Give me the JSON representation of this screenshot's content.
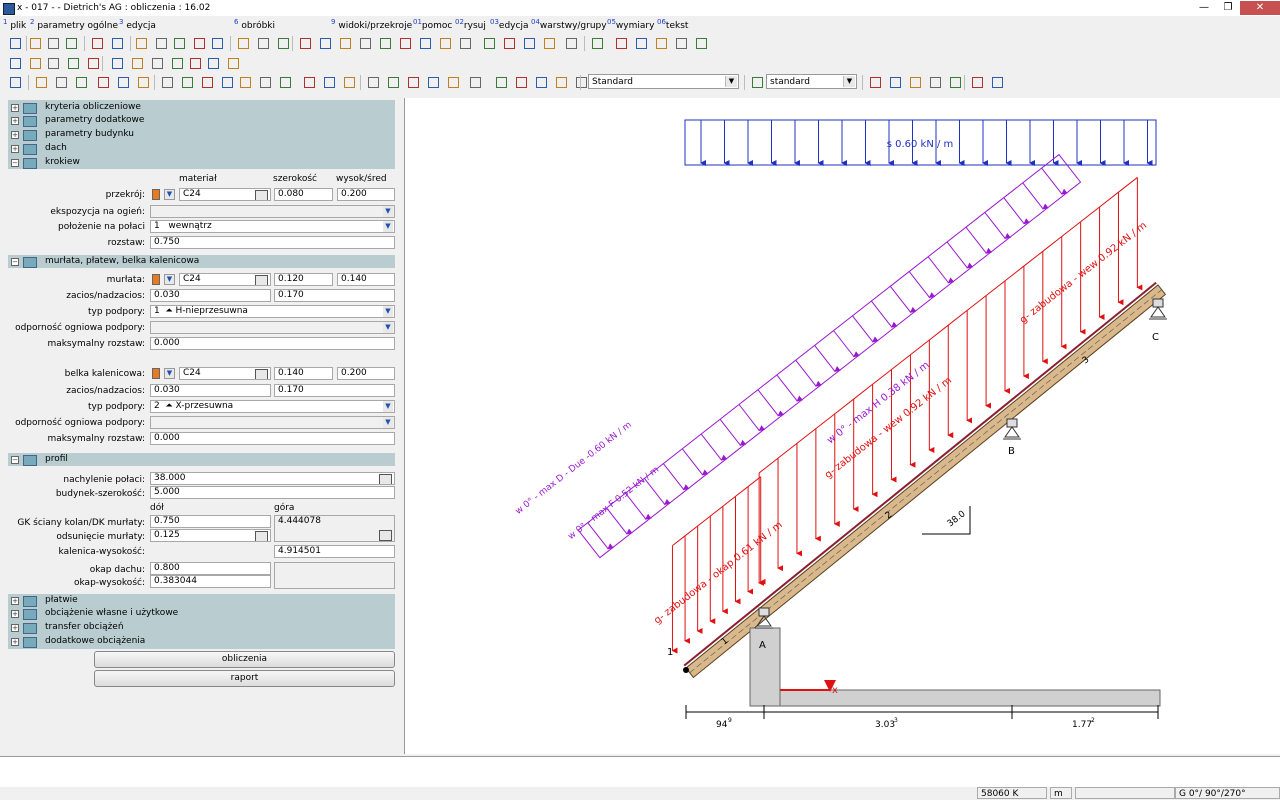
{
  "window": {
    "title": "x - 017 -  - Dietrich's AG : obliczenia : 16.02"
  },
  "menu": [
    {
      "num": "1",
      "label": "plik"
    },
    {
      "num": "2",
      "label": "parametry ogólne"
    },
    {
      "num": "3",
      "label": "edycja"
    },
    {
      "num": "6",
      "label": "obróbki"
    },
    {
      "num": "9",
      "label": "widoki/przekroje"
    },
    {
      "num": "01",
      "label": "pomoc"
    },
    {
      "num": "02",
      "label": "rysuj"
    },
    {
      "num": "03",
      "label": "edycja"
    },
    {
      "num": "04",
      "label": "warstwy/grupy"
    },
    {
      "num": "05",
      "label": "wymiary"
    },
    {
      "num": "06",
      "label": "tekst"
    }
  ],
  "toolbar": {
    "style_combo": "Standard",
    "line_combo": "standard"
  },
  "groups_top": [
    {
      "label": "kryteria obliczeniowe",
      "expanded": false
    },
    {
      "label": "parametry dodatkowe",
      "expanded": false
    },
    {
      "label": "parametry budynku",
      "expanded": false
    },
    {
      "label": "dach",
      "expanded": false
    },
    {
      "label": "krokiew",
      "expanded": true
    }
  ],
  "krokiew": {
    "col_material": "materiał",
    "col_width": "szerokość",
    "col_height": "wysok/śred",
    "przekroj_label": "przekrój:",
    "przekroj_material": "C24",
    "przekroj_width": "0.080",
    "przekroj_height": "0.200",
    "fire_label": "ekspozycja na ogień:",
    "fire_value": "",
    "position_label": "położenie na połaci",
    "position_num": "1",
    "position_value": "wewnątrz",
    "spacing_label": "rozstaw:",
    "spacing_value": "0.750"
  },
  "murlata_group": {
    "label": "murłata, płatew, belka kalenicowa"
  },
  "murlata": {
    "label": "murłata:",
    "material": "C24",
    "width": "0.120",
    "height": "0.140",
    "notch_label": "zacios/nadzacios:",
    "notch_a": "0.030",
    "notch_b": "0.170",
    "support_label": "typ podpory:",
    "support_num": "1",
    "support_value": "H-nieprzesuwna",
    "fire_label": "odporność ogniowa podpory:",
    "fire_value": "",
    "maxspacing_label": "maksymalny rozstaw:",
    "maxspacing_value": "0.000"
  },
  "belka": {
    "label": "belka kalenicowa:",
    "material": "C24",
    "width": "0.140",
    "height": "0.200",
    "notch_label": "zacios/nadzacios:",
    "notch_a": "0.030",
    "notch_b": "0.170",
    "support_label": "typ podpory:",
    "support_num": "2",
    "support_value": "X-przesuwna",
    "fire_label": "odporność ogniowa podpory:",
    "fire_value": "",
    "maxspacing_label": "maksymalny rozstaw:",
    "maxspacing_value": "0.000"
  },
  "profil_group": {
    "label": "profil"
  },
  "profil": {
    "slope_label": "nachylenie połaci:",
    "slope_value": "38.000",
    "bw_label": "budynek-szerokość:",
    "bw_value": "5.000",
    "col_bottom": "dół",
    "col_top": "góra",
    "gk_label": "GK ściany kolan/DK murłaty:",
    "gk_bottom": "0.750",
    "gk_top": "4.444078",
    "offset_label": "odsunięcie murłaty:",
    "offset_value": "0.125",
    "ridge_label": "kalenica-wysokość:",
    "ridge_value": "4.914501",
    "eave_label": "okap dachu:",
    "eave_value": "0.800",
    "eaveh_label": "okap-wysokość:",
    "eaveh_value": "0.383044"
  },
  "groups_bottom": [
    {
      "label": "płatwie"
    },
    {
      "label": "obciążenie własne i użytkowe"
    },
    {
      "label": "transfer obciążeń"
    },
    {
      "label": "dodatkowe obciążenia"
    }
  ],
  "buttons": {
    "calculate": "obliczenia",
    "report": "raport"
  },
  "drawing": {
    "snow_load": "s 0.60 kN / m",
    "wind_max": "w 0° - max H 0.38 kN / m",
    "wind_d": "w 0° - max D - Due -0.60 kN / m",
    "wind_f": "w 0° - max F 0.52 kN / m",
    "dead_top": "g- zabudowa - wew 0.92 kN / m",
    "dead_mid": "g- zabudowa - wew 0.92 kN / m",
    "dead_eave": "g- zabudowa - okap 0.61 kN / m",
    "support_a": "A",
    "support_b": "B",
    "support_c": "C",
    "node_1": "1",
    "member_1": "1",
    "member_2": "2",
    "member_3": "3",
    "angle": "38.0",
    "axis_x": "x",
    "dim_1": "94",
    "dim_1_sup": "9",
    "dim_2": "3.03",
    "dim_2_sup": "3",
    "dim_3": "1.77",
    "dim_3_sup": "2",
    "colors": {
      "snow": "#2030c0",
      "wind": "#9a18d0",
      "dead": "#e01010",
      "rafter": "#d9b88c",
      "concrete": "#d0d0d0"
    }
  },
  "status": {
    "memory": "58060 K",
    "unit": "m",
    "view": "G  0°/ 90°/270°"
  }
}
